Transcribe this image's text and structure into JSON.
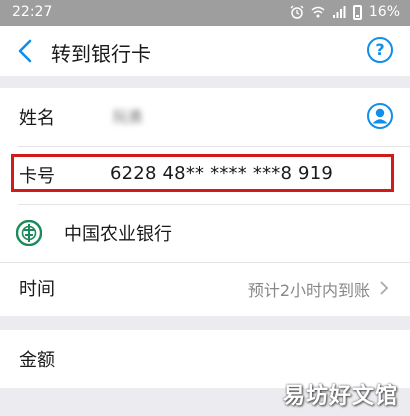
{
  "status_bar": {
    "time": "22:27",
    "battery": "16%",
    "icons": [
      "alarm-icon",
      "wifi-icon",
      "signal-icon",
      "battery-icon"
    ]
  },
  "header": {
    "title": "转到银行卡",
    "back_icon": "chevron-left-icon",
    "help_label": "?"
  },
  "recipient": {
    "name_label": "姓名",
    "name_value": "阮勇",
    "contact_icon": "user-contact-icon"
  },
  "card": {
    "label": "卡号",
    "number": "6228 48** **** ***8 919"
  },
  "bank": {
    "name": "中国农业银行",
    "logo_icon": "abc-bank-logo-icon"
  },
  "timing": {
    "label": "时间",
    "value": "预计2小时内到账"
  },
  "amount": {
    "label": "金额"
  },
  "watermark": "易坊好文馆",
  "colors": {
    "accent": "#108ee9",
    "highlight": "#d11a1a",
    "bank_green": "#1a8a5a",
    "background": "#ececf0"
  }
}
